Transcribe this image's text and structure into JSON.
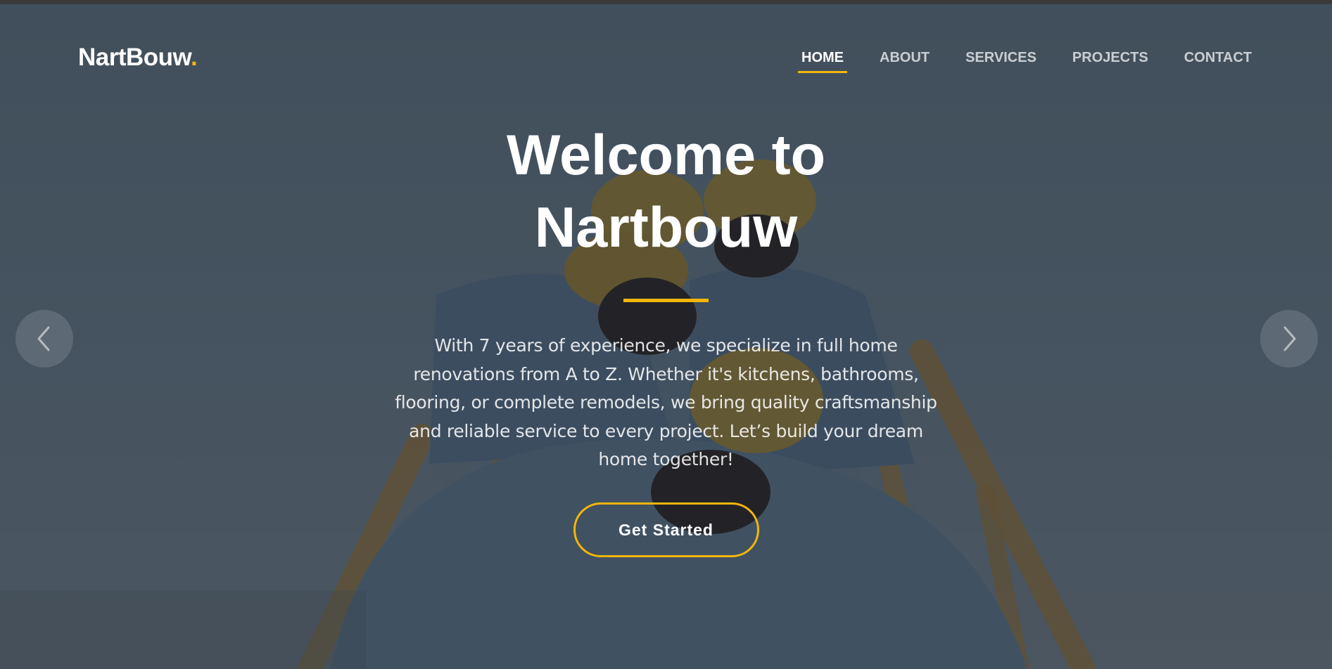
{
  "brand": {
    "name": "NartBouw",
    "dot": ".",
    "accent_color": "#f5b50a"
  },
  "nav": {
    "items": [
      {
        "label": "HOME",
        "active": true
      },
      {
        "label": "ABOUT",
        "active": false
      },
      {
        "label": "SERVICES",
        "active": false
      },
      {
        "label": "PROJECTS",
        "active": false
      },
      {
        "label": "CONTACT",
        "active": false
      }
    ]
  },
  "hero": {
    "title": "Welcome to Nartbouw",
    "description": "With 7 years of experience, we specialize in full home renovations from A to Z. Whether it's kitchens, bathrooms, flooring, or complete remodels, we bring quality craftsmanship and reliable service to every project. Let’s build your dream home together!",
    "cta_label": "Get Started",
    "background_image": "construction-workers-hard-hats-climbing-ladder-photo"
  },
  "carousel": {
    "prev_icon": "chevron-left-icon",
    "next_icon": "chevron-right-icon"
  }
}
